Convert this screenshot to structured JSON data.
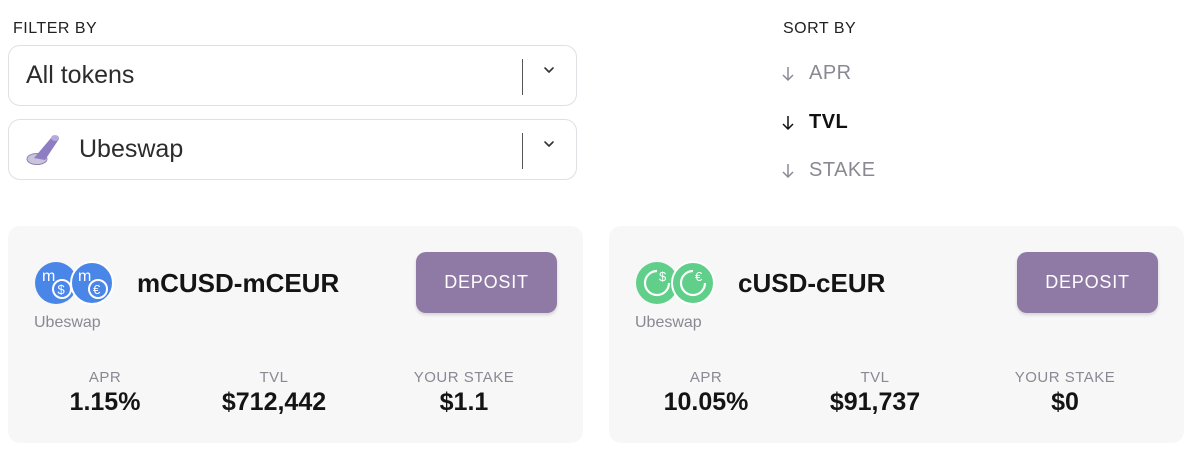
{
  "filter": {
    "label": "FILTER BY",
    "token_select": {
      "value": "All tokens"
    },
    "exchange_select": {
      "value": "Ubeswap",
      "icon": "ubeswap-logo-icon"
    }
  },
  "sort": {
    "label": "SORT BY",
    "options": [
      {
        "label": "APR",
        "active": false
      },
      {
        "label": "TVL",
        "active": true
      },
      {
        "label": "STAKE",
        "active": false
      }
    ]
  },
  "pools": [
    {
      "name": "mCUSD-mCEUR",
      "exchange": "Ubeswap",
      "token_color": "#4a86e8",
      "deposit_label": "DEPOSIT",
      "stats": {
        "apr_label": "APR",
        "apr": "1.15%",
        "tvl_label": "TVL",
        "tvl": "$712,442",
        "stake_label": "YOUR STAKE",
        "stake": "$1.1"
      }
    },
    {
      "name": "cUSD-cEUR",
      "exchange": "Ubeswap",
      "token_color": "#5fcf8a",
      "deposit_label": "DEPOSIT",
      "stats": {
        "apr_label": "APR",
        "apr": "10.05%",
        "tvl_label": "TVL",
        "tvl": "$91,737",
        "stake_label": "YOUR STAKE",
        "stake": "$0"
      }
    }
  ],
  "colors": {
    "deposit_button": "#8f7aa6",
    "muted_text": "#8a8893",
    "card_background": "#f7f7f7"
  }
}
